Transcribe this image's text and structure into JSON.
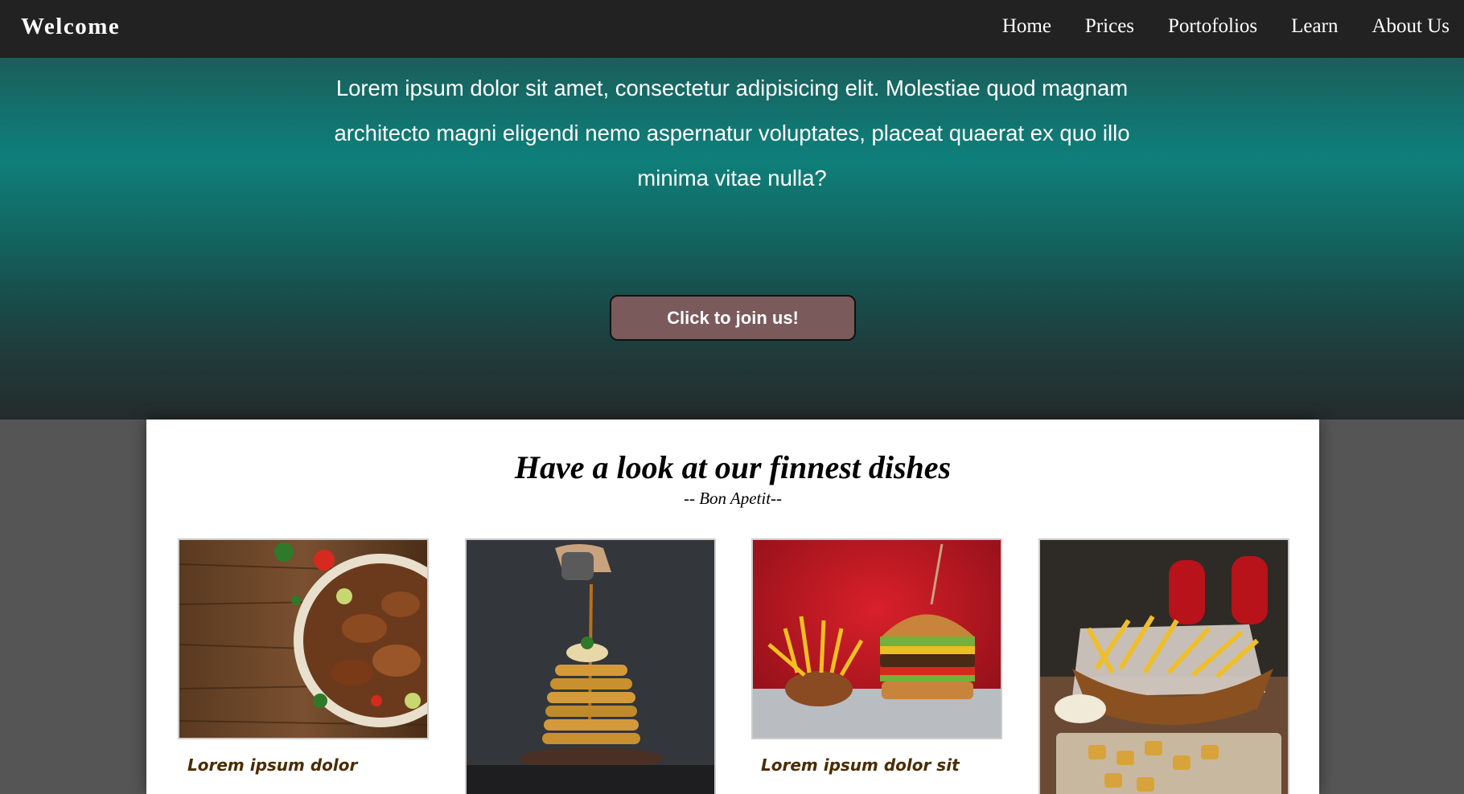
{
  "navbar": {
    "brand": "Welcome",
    "links": [
      "Home",
      "Prices",
      "Portofolios",
      "Learn",
      "About Us"
    ]
  },
  "hero": {
    "text": "Lorem ipsum dolor sit amet, consectetur adipisicing elit. Molestiae quod magnam architecto magni eligendi nemo aspernatur voluptates, placeat quaerat ex quo illo minima vitae nulla?",
    "button_label": "Click to join us!"
  },
  "dishes": {
    "title": "Have a look at our finnest dishes",
    "subtitle": "-- Bon Apetit--",
    "cards": [
      {
        "image": "grilled-chicken-wings-photo",
        "caption": "Lorem ipsum dolor"
      },
      {
        "image": "pancake-stack-photo",
        "caption": ""
      },
      {
        "image": "burger-and-fries-photo",
        "caption": "Lorem ipsum dolor sit"
      },
      {
        "image": "fries-basket-photo",
        "caption": ""
      }
    ]
  },
  "colors": {
    "navbar": "#222222",
    "hero_teal": "#0f7f7a",
    "button": "#7b5a5c",
    "caption": "#4a2c00",
    "page_bg": "#555555"
  }
}
